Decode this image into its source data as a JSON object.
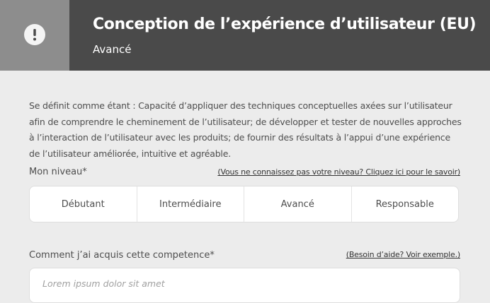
{
  "header": {
    "title": "Conception de l’expérience d’utilisateur (EU)",
    "subtitle": "Avancé",
    "icon": "exclamation-circle-icon",
    "bg_color": "#4a4a4a",
    "side_color": "#8d8d8d"
  },
  "description": "Se définit comme étant : Capacité d’appliquer des techniques conceptuelles axées sur l’utilisateur afin de comprendre le cheminement de l’utilisateur; de développer et tester de nouvelles approches à l’interaction de l’utilisateur avec les produits; de fournir des résultats à l’appui d’une expérience de l’utilisateur améliorée, intuitive et agréable.",
  "level": {
    "label": "Mon niveau*",
    "help_link": "(Vous ne connaissez pas votre niveau? Cliquez ici pour le savoir)",
    "options": [
      "Débutant",
      "Intermédiaire",
      "Avancé",
      "Responsable"
    ]
  },
  "acquired": {
    "label": "Comment j’ai acquis cette competence*",
    "help_link": "(Besoin d’aide? Voir exemple.)",
    "placeholder": "Lorem ipsum dolor sit amet"
  }
}
